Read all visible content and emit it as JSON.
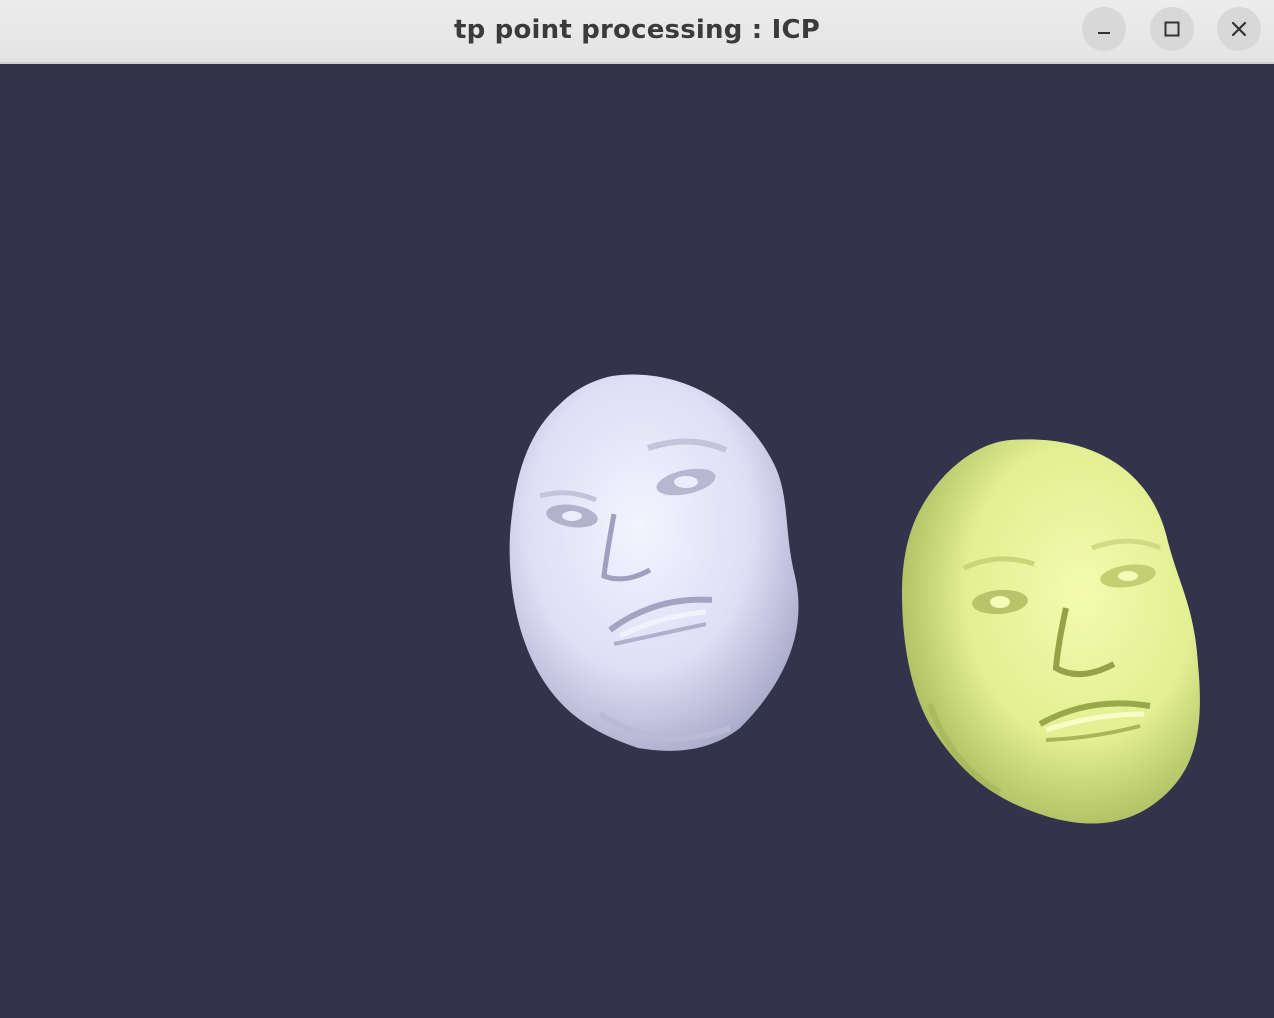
{
  "window": {
    "title": "tp point processing : ICP",
    "background_color": "#33334b",
    "controls": {
      "minimize_icon": "minimize-icon",
      "maximize_icon": "maximize-icon",
      "close_icon": "close-icon"
    }
  },
  "scene": {
    "meshes": [
      {
        "name": "source-face-mesh",
        "color": "#e6e6fb"
      },
      {
        "name": "target-face-mesh",
        "color": "#eaf59a"
      }
    ]
  }
}
